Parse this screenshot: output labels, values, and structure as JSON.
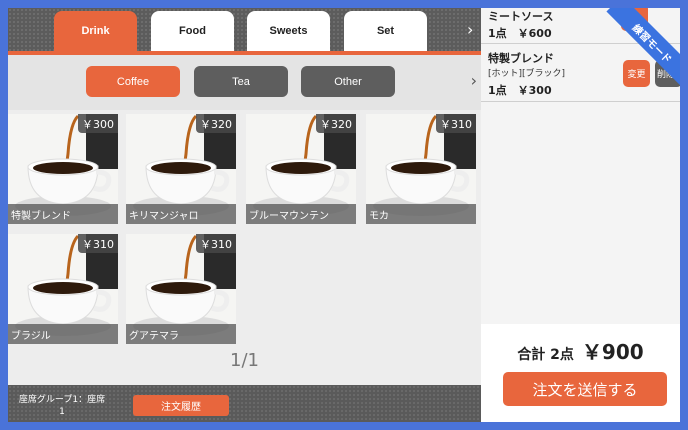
{
  "categories": {
    "tabs": [
      {
        "label": "Drink",
        "active": true
      },
      {
        "label": "Food",
        "active": false
      },
      {
        "label": "Sweets",
        "active": false
      },
      {
        "label": "Set",
        "active": false
      }
    ]
  },
  "subcategories": {
    "buttons": [
      {
        "label": "Coffee",
        "active": true
      },
      {
        "label": "Tea",
        "active": false
      },
      {
        "label": "Other",
        "active": false
      }
    ]
  },
  "products": [
    {
      "name": "特製ブレンド",
      "price": "￥300"
    },
    {
      "name": "キリマンジャロ",
      "price": "￥320"
    },
    {
      "name": "ブルーマウンテン",
      "price": "￥320"
    },
    {
      "name": "モカ",
      "price": "￥310"
    },
    {
      "name": "ブラジル",
      "price": "￥310"
    },
    {
      "name": "グアテマラ",
      "price": "￥310"
    }
  ],
  "pager": "1/1",
  "footer": {
    "seat_line1": "座席グループ1：座席",
    "seat_line2": "1",
    "history_label": "注文履歴"
  },
  "order": {
    "items": [
      {
        "title": "ミートソース",
        "options": "",
        "qty": "1点　￥600"
      },
      {
        "title": "特製ブレンド",
        "options": "[ホット][ブラック]",
        "qty": "1点　￥300",
        "change_label": "変更",
        "delete_label": "削除"
      }
    ],
    "total_label": "合計 2点",
    "total_amount": "￥900",
    "send_label": "注文を送信する"
  },
  "badge": "練習モード",
  "colors": {
    "accent": "#e8663d",
    "badge": "#3b73e0",
    "frame": "#4a73d9"
  }
}
